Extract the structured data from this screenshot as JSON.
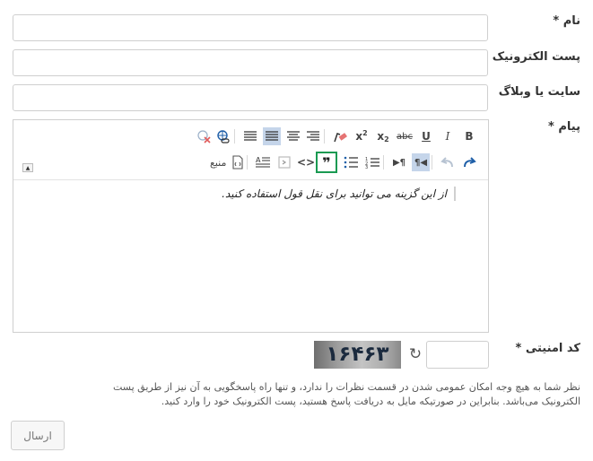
{
  "form": {
    "name_label": "نام",
    "email_label": "پست الکترونیک",
    "website_label": "سایت یا وبلاگ",
    "message_label": "پیام",
    "required_mark": "*",
    "security_code_label": "کد امنیتی",
    "submit_label": "ارسال"
  },
  "editor": {
    "toolbar_row1": [
      "B",
      "I",
      "U",
      "abc",
      "x₂",
      "x²",
      "eraser",
      "align-left",
      "align-center",
      "align-right",
      "align-justify",
      "link",
      "unlink"
    ],
    "toolbar_row2": [
      "redo",
      "undo",
      "rtl",
      "ltr",
      "blockquote",
      "code",
      "ordered-list",
      "unordered-list"
    ],
    "source_label": "منبع",
    "content": "از این گزینه می توانید برای نقل قول استفاده کنید."
  },
  "captcha": {
    "image_text": "۱۶۴۶۳"
  },
  "note": "نظر شما به هیچ وجه امکان عمومی شدن در قسمت نظرات را ندارد، و تنها راه پاسخگویی به آن نیز از طریق پست الکترونیک می‌باشد. بنابراین در صورتیکه مایل به دریافت پاسخ هستید، پست الکترونیک خود را وارد کنید."
}
